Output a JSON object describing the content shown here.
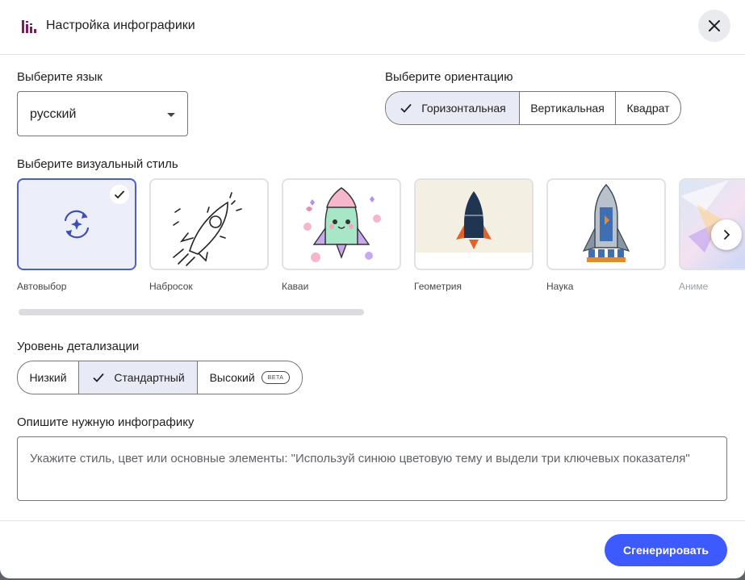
{
  "dialog": {
    "title": "Настройка инфографики",
    "app_icon": "bar-chart-icon",
    "close_icon": "close-icon"
  },
  "language": {
    "label": "Выберите язык",
    "selected": "русский"
  },
  "orientation": {
    "label": "Выберите ориентацию",
    "options": [
      "Горизонтальная",
      "Вертикальная",
      "Квадрат"
    ],
    "selected": "Горизонтальная"
  },
  "visual_style": {
    "label": "Выберите визуальный стиль",
    "options": [
      {
        "label": "Автовыбор",
        "icon": "auto-refresh-icon"
      },
      {
        "label": "Набросок",
        "icon": "sketch-rocket-image"
      },
      {
        "label": "Каваи",
        "icon": "kawaii-rocket-image"
      },
      {
        "label": "Геометрия",
        "icon": "geometric-rocket-image"
      },
      {
        "label": "Наука",
        "icon": "science-rocket-image"
      },
      {
        "label": "Аниме",
        "icon": "anime-image"
      }
    ],
    "selected": "Автовыбор",
    "next_icon": "chevron-right-icon"
  },
  "detail": {
    "label": "Уровень детализации",
    "options": [
      "Низкий",
      "Стандартный",
      "Высокий"
    ],
    "beta_badge": "BETA",
    "selected": "Стандартный"
  },
  "description": {
    "label": "Опишите нужную инфографику",
    "placeholder": "Укажите стиль, цвет или основные элементы: \"Используй синюю цветовую тему и выдели три ключевых показателя\""
  },
  "actions": {
    "generate": "Сгенерировать"
  },
  "colors": {
    "accent": "#3d5afe",
    "selected_fill": "#e8eaf6",
    "selected_border": "#4c5fc9"
  }
}
